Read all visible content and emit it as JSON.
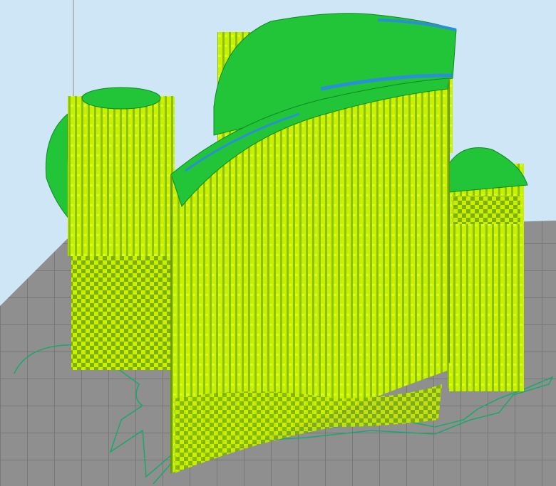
{
  "viewport": {
    "background": "#cfe6f7",
    "build_plate_color": "#8f8f8f",
    "grid_line_color": "#6e6e6e",
    "axis_line_color": "#a7a7a7"
  },
  "model": {
    "wall_color": "#c8f000",
    "wall_stripe_color": "#7fb000",
    "top_surface_color": "#22c438",
    "overhang_edge_color": "#2a8fd6",
    "skirt_color": "#1aa86a"
  }
}
